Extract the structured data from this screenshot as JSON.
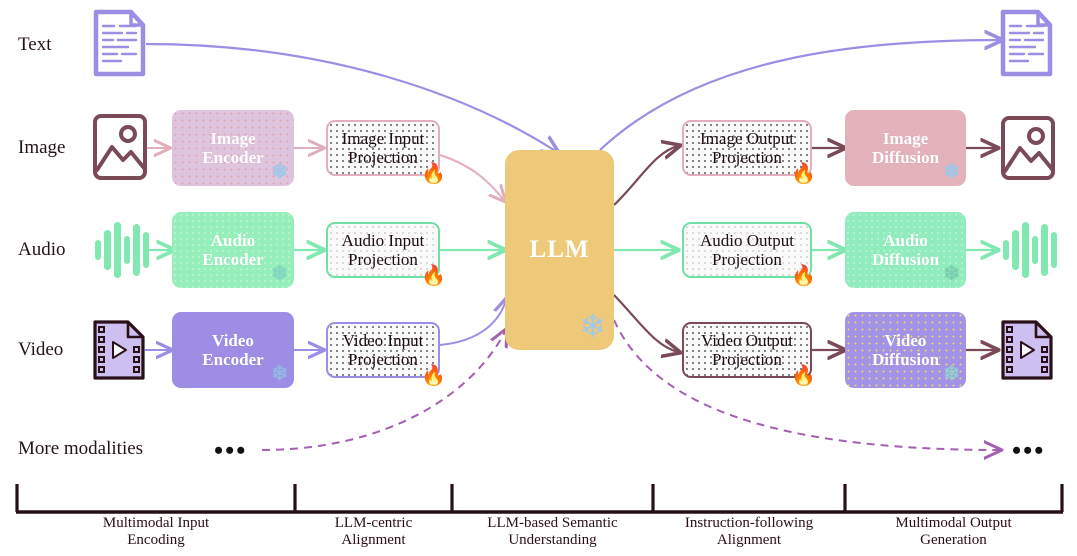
{
  "figure": {
    "title": "Multimodal LLM pipeline overview",
    "row_labels": [
      {
        "id": "text",
        "label": "Text"
      },
      {
        "id": "image",
        "label": "Image"
      },
      {
        "id": "audio",
        "label": "Audio"
      },
      {
        "id": "video",
        "label": "Video"
      },
      {
        "id": "more",
        "label": "More modalities"
      }
    ],
    "encoders": [
      {
        "id": "image-encoder",
        "line1": "Image",
        "line2": "Encoder",
        "fill": "#dfc4dd",
        "border": "#dfc4dd",
        "state": "frozen"
      },
      {
        "id": "audio-encoder",
        "line1": "Audio",
        "line2": "Encoder",
        "fill": "#96eebb",
        "border": "#96eebb",
        "state": "frozen"
      },
      {
        "id": "video-encoder",
        "line1": "Video",
        "line2": "Encoder",
        "fill": "#9d8de4",
        "border": "#9d8de4",
        "state": "frozen"
      }
    ],
    "input_projections": [
      {
        "id": "image-input-projection",
        "line1": "Image Input",
        "line2": "Projection",
        "border": "#e3aebb",
        "state": "tunable"
      },
      {
        "id": "audio-input-projection",
        "line1": "Audio Input",
        "line2": "Projection",
        "border": "#6fe0a6",
        "state": "tunable"
      },
      {
        "id": "video-input-projection",
        "line1": "Video Input",
        "line2": "Projection",
        "border": "#9d8de4",
        "state": "tunable"
      }
    ],
    "llm": {
      "id": "llm",
      "label": "LLM",
      "fill": "#efc濃",
      "state": "frozen"
    },
    "llm_block": {
      "label": "LLM",
      "fill": "#eec97a",
      "state": "frozen"
    },
    "output_projections": [
      {
        "id": "image-output-projection",
        "line1": "Image Output",
        "line2": "Projection",
        "border": "#e3aebb",
        "state": "tunable"
      },
      {
        "id": "audio-output-projection",
        "line1": "Audio Output",
        "line2": "Projection",
        "border": "#6fe0a6",
        "state": "tunable"
      },
      {
        "id": "video-output-projection",
        "line1": "Video Output",
        "line2": "Projection",
        "border": "#7a4a57",
        "state": "tunable"
      }
    ],
    "diffusions": [
      {
        "id": "image-diffusion",
        "line1": "Image",
        "line2": "Diffusion",
        "fill": "#e3b2bb",
        "state": "frozen"
      },
      {
        "id": "audio-diffusion",
        "line1": "Audio",
        "line2": "Diffusion",
        "fill": "#90ecbd",
        "state": "frozen"
      },
      {
        "id": "video-diffusion",
        "line1": "Video",
        "line2": "Diffusion",
        "fill": "#a393e6",
        "state": "frozen"
      }
    ],
    "stage_axis": {
      "stages": [
        {
          "id": "stage-1",
          "line1": "Multimodal Input",
          "line2": "Encoding"
        },
        {
          "id": "stage-2",
          "line1": "LLM-centric",
          "line2": "Alignment"
        },
        {
          "id": "stage-3",
          "line1": "LLM-based Semantic",
          "line2": "Understanding"
        },
        {
          "id": "stage-4",
          "line1": "Instruction-following",
          "line2": "Alignment"
        },
        {
          "id": "stage-5",
          "line1": "Multimodal Output",
          "line2": "Generation"
        }
      ]
    },
    "ellipsis_marks": {
      "left": "•••",
      "right": "•••"
    },
    "icons": {
      "snowflake": "❄",
      "fire": "🔥",
      "frozen_meaning": "frozen / not trained",
      "tunable_meaning": "trainable / fine-tuned"
    },
    "colors": {
      "text_purple": "#9d8de4",
      "image_pink": "#e3aebb",
      "image_brown": "#7a4a57",
      "audio_green": "#80e8b0",
      "video_purple": "#9d8de4",
      "llm_gold": "#eec97a",
      "snow_blue": "#9fc8ea",
      "axis_black": "#241016"
    }
  }
}
